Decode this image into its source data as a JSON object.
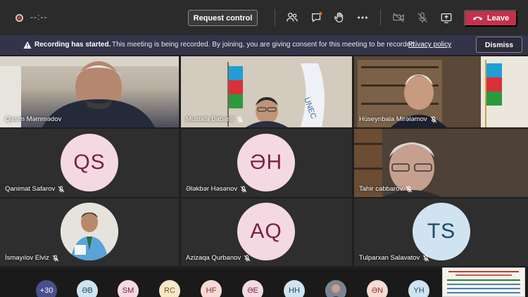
{
  "toolbar": {
    "timer": "--:--",
    "request_control": "Request control",
    "leave": "Leave",
    "icons": [
      "people-icon",
      "chat-icon",
      "raise-hand-icon",
      "more-icon",
      "camera-off-icon",
      "mic-off-icon",
      "share-icon"
    ]
  },
  "banner": {
    "title": "Recording has started.",
    "message": "This meeting is being recorded. By joining, you are giving consent for this meeting to be recorded.",
    "link": "Privacy policy",
    "dismiss": "Dismiss"
  },
  "participants": [
    {
      "name": "Qasım Məmmədov",
      "muted": false
    },
    {
      "name": "Mustafa Babanli",
      "muted": true
    },
    {
      "name": "Hüseynbala Mirələmov",
      "muted": true
    },
    {
      "name": "Qanimat Safarov",
      "muted": true,
      "initials": "QS"
    },
    {
      "name": "Ələkbər Həsənov",
      "muted": true,
      "initials": "ƏH"
    },
    {
      "name": "Tahir cabbarov",
      "muted": true
    },
    {
      "name": "İsmayılov Elviz",
      "muted": true
    },
    {
      "name": "Azizaqa Qurbanov",
      "muted": true,
      "initials": "AQ"
    },
    {
      "name": "Tulparxan Salavatov",
      "muted": true,
      "initials": "TS"
    }
  ],
  "strip": {
    "overflow": "+30",
    "avatars": [
      "ƏB",
      "SM",
      "RC",
      "HF",
      "ƏE",
      "HH",
      "",
      "ƏN",
      "YH"
    ]
  },
  "colors": {
    "leave": "#c4314b",
    "avatar_pink": "#f4d9e3",
    "avatar_pink_text": "#7a2140",
    "avatar_blue": "#cfe4f0",
    "avatar_blue_text": "#204a63",
    "banner": "#33344a"
  }
}
